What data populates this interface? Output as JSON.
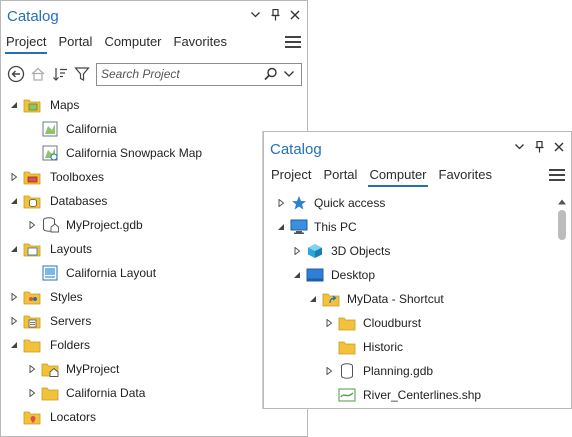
{
  "catalog_main": {
    "title": "Catalog",
    "tabs": [
      "Project",
      "Portal",
      "Computer",
      "Favorites"
    ],
    "active_tab": "Project",
    "search": {
      "placeholder": "Search Project"
    },
    "tree": [
      {
        "label": "Maps",
        "expanded": true,
        "icon": "maps-folder-icon"
      },
      {
        "label": "California",
        "icon": "map-icon"
      },
      {
        "label": "California Snowpack Map",
        "icon": "map-icon"
      },
      {
        "label": "Toolboxes",
        "expanded": false,
        "icon": "toolboxes-folder-icon"
      },
      {
        "label": "Databases",
        "expanded": true,
        "icon": "databases-folder-icon"
      },
      {
        "label": "MyProject.gdb",
        "expanded": false,
        "icon": "geodatabase-icon"
      },
      {
        "label": "Layouts",
        "expanded": true,
        "icon": "layouts-folder-icon"
      },
      {
        "label": "California Layout",
        "icon": "layout-icon"
      },
      {
        "label": "Styles",
        "expanded": false,
        "icon": "styles-folder-icon"
      },
      {
        "label": "Servers",
        "expanded": false,
        "icon": "servers-folder-icon"
      },
      {
        "label": "Folders",
        "expanded": true,
        "icon": "folders-folder-icon"
      },
      {
        "label": "MyProject",
        "expanded": false,
        "icon": "home-folder-icon"
      },
      {
        "label": "California Data",
        "expanded": false,
        "icon": "folder-icon"
      },
      {
        "label": "Locators",
        "icon": "locators-folder-icon"
      }
    ]
  },
  "catalog_computer": {
    "title": "Catalog",
    "tabs": [
      "Project",
      "Portal",
      "Computer",
      "Favorites"
    ],
    "active_tab": "Computer",
    "tree": [
      {
        "label": "Quick access",
        "expanded": false,
        "icon": "star-icon"
      },
      {
        "label": "This PC",
        "expanded": true,
        "icon": "computer-icon"
      },
      {
        "label": "3D Objects",
        "expanded": false,
        "icon": "3d-objects-icon"
      },
      {
        "label": "Desktop",
        "expanded": true,
        "icon": "desktop-icon"
      },
      {
        "label": "MyData - Shortcut",
        "expanded": true,
        "icon": "folder-shortcut-icon"
      },
      {
        "label": "Cloudburst",
        "expanded": false,
        "icon": "folder-icon"
      },
      {
        "label": "Historic",
        "icon": "folder-icon"
      },
      {
        "label": "Planning.gdb",
        "expanded": false,
        "icon": "geodatabase-icon"
      },
      {
        "label": "River_Centerlines.shp",
        "icon": "shapefile-line-icon"
      }
    ]
  },
  "colors": {
    "accent": "#2470b8",
    "folder": "#f3c23c"
  }
}
